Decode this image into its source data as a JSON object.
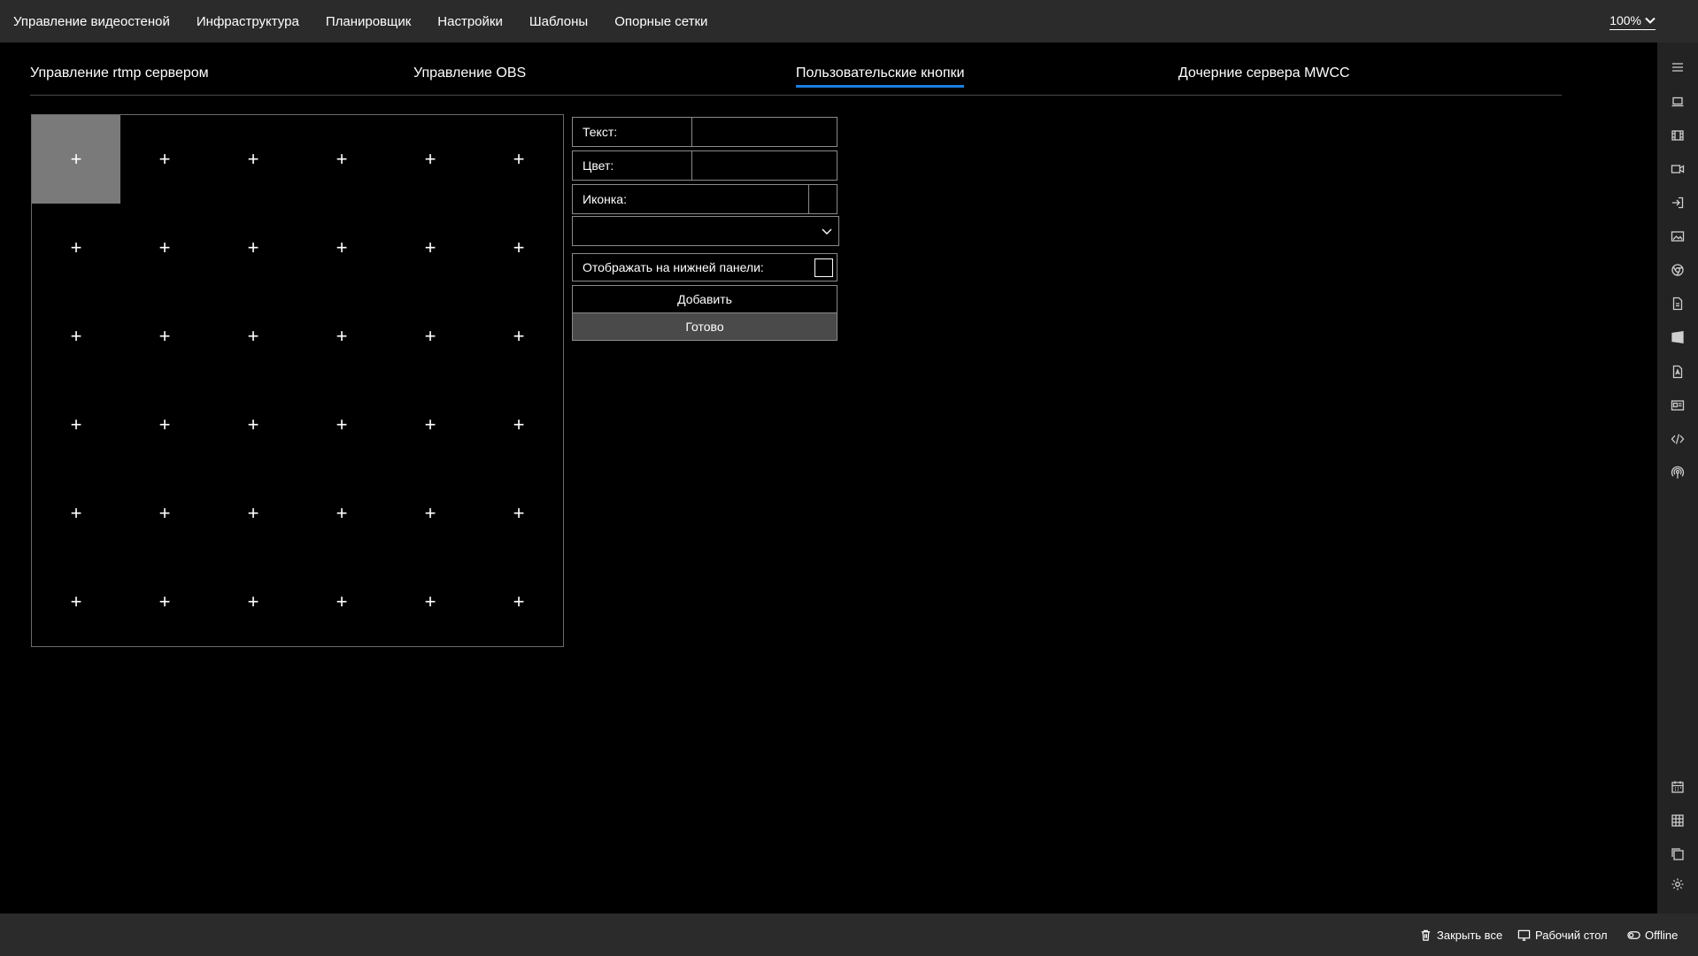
{
  "topmenu": {
    "items": [
      {
        "label": "Управление видеостеной"
      },
      {
        "label": "Инфраструктура"
      },
      {
        "label": "Планировщик"
      },
      {
        "label": "Настройки"
      },
      {
        "label": "Шаблоны"
      },
      {
        "label": "Опорные сетки"
      }
    ],
    "zoom": "100%"
  },
  "tabs": {
    "items": [
      {
        "label": "Управление rtmp сервером"
      },
      {
        "label": "Управление OBS"
      },
      {
        "label": "Пользовательские кнопки"
      },
      {
        "label": "Дочерние сервера MWCC"
      }
    ],
    "active_index": 2
  },
  "button_grid": {
    "rows": 6,
    "columns": 6,
    "cell_symbol": "+",
    "selected_cell": 0
  },
  "form": {
    "text_label": "Текст:",
    "text_value": "",
    "color_label": "Цвет:",
    "color_value": "",
    "icon_label": "Иконка:",
    "select_value": "",
    "show_bottom_label": "Отображать на нижней панели:",
    "show_bottom_checked": false,
    "add_label": "Добавить",
    "done_label": "Готово"
  },
  "right_sidebar": {
    "icons": [
      "menu-icon",
      "laptop-icon",
      "film-icon",
      "video-camera-icon",
      "sign-in-icon",
      "image-icon",
      "chrome-icon",
      "document-icon",
      "windows-icon",
      "pdf-icon",
      "id-card-icon",
      "code-icon",
      "broadcast-icon",
      "calendar-icon",
      "table-icon",
      "copy-icon",
      "settings-icon"
    ]
  },
  "bottombar": {
    "close_all": "Закрыть все",
    "desktop": "Рабочий стол",
    "status": "Offline"
  },
  "colors": {
    "accent": "#1a7fe0",
    "topbar_bg": "#2b2b2b",
    "sidebar_bg": "#232323",
    "selected_cell": "#7a7a7a",
    "done_button_bg": "#4a4a4a"
  }
}
